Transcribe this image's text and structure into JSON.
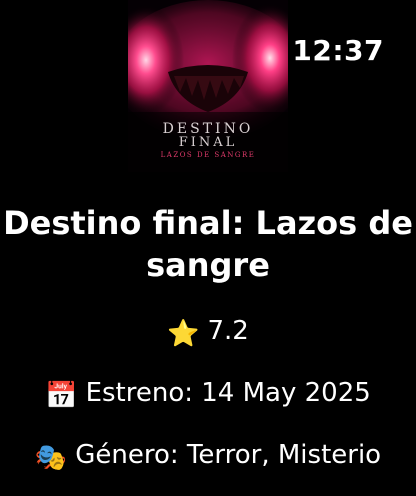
{
  "status_bar": {
    "time": "12:37"
  },
  "poster": {
    "title_line1": "DESTINO",
    "title_line2": "FINAL",
    "subtitle": "LAZOS DE SANGRE",
    "accent_color": "#e8306e"
  },
  "movie": {
    "title": "Destino final: Lazos de sangre",
    "rating_icon": "star-icon",
    "rating": "7.2",
    "release_icon": "calendar-icon",
    "release_text": "Estreno: 14 May 2025",
    "genre_icon": "theater-masks-icon",
    "genre_text": "Género: Terror, Misterio"
  }
}
